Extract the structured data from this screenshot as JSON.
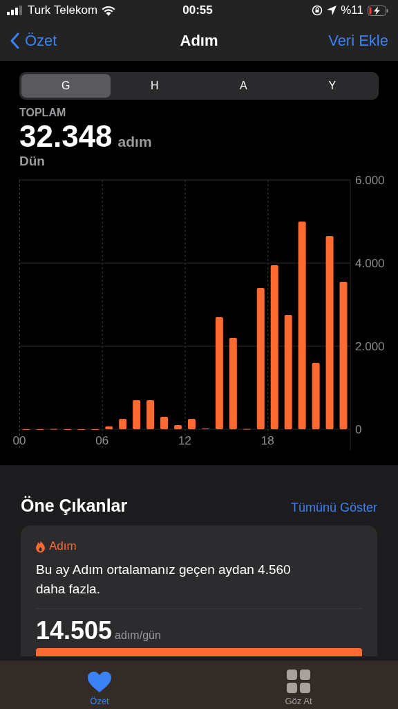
{
  "status_bar": {
    "carrier": "Turk Telekom",
    "time": "00:55",
    "battery": "%11"
  },
  "nav": {
    "back": "Özet",
    "title": "Adım",
    "action": "Veri Ekle"
  },
  "segments": [
    {
      "label": "G",
      "selected": true
    },
    {
      "label": "H",
      "selected": false
    },
    {
      "label": "A",
      "selected": false
    },
    {
      "label": "Y",
      "selected": false
    }
  ],
  "summary": {
    "label": "TOPLAM",
    "value": "32.348",
    "unit": "adım",
    "date": "Dün"
  },
  "chart_data": {
    "type": "bar",
    "x": [
      0.5,
      1.5,
      2.5,
      3.5,
      4.5,
      5.5,
      6.5,
      7.5,
      8.5,
      9.5,
      10.5,
      11.5,
      12.5,
      13.5,
      14.5,
      15.5,
      16.5,
      17.5,
      18.5,
      19.5,
      20.5,
      21.5,
      22.5,
      23.5
    ],
    "xlim": [
      0,
      24
    ],
    "grid": true,
    "series": [
      {
        "color": "#ff6a33",
        "values": [
          0,
          0,
          10,
          0,
          0,
          0,
          70,
          250,
          700,
          700,
          300,
          100,
          250,
          20,
          2700,
          2200,
          10,
          3400,
          3950,
          2750,
          5000,
          1600,
          4650,
          3550
        ]
      }
    ],
    "ylim": [
      0,
      6000
    ],
    "yticks": [
      {
        "value": 0,
        "label": "0"
      },
      {
        "value": 2000,
        "label": "2.000"
      },
      {
        "value": 4000,
        "label": "4.000"
      },
      {
        "value": 6000,
        "label": "6.000"
      }
    ],
    "xticks": [
      {
        "value": 0,
        "label": "00"
      },
      {
        "value": 6,
        "label": "06"
      },
      {
        "value": 12,
        "label": "12"
      },
      {
        "value": 18,
        "label": "18"
      }
    ]
  },
  "highlights": {
    "title": "Öne Çıkanlar",
    "show_all": "Tümünü Göster",
    "card": {
      "category": "Adım",
      "text": "Bu ay Adım ortalamanız geçen aydan 4.560 daha fazla.",
      "value": "14.505",
      "unit": "adım/gün"
    }
  },
  "tab_bar": [
    {
      "label": "Özet",
      "kind": "heart",
      "selected": true
    },
    {
      "label": "Göz At",
      "kind": "grid",
      "selected": false
    }
  ]
}
